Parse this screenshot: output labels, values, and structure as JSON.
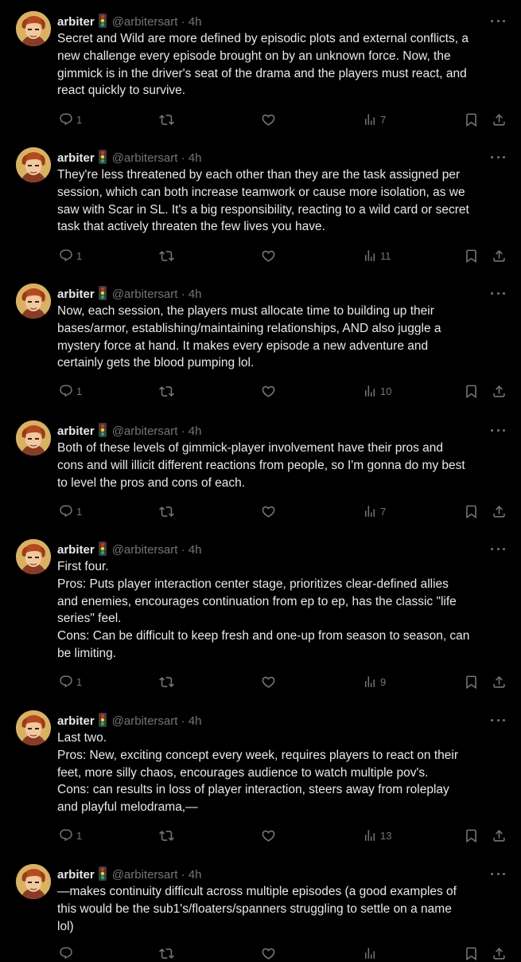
{
  "colors": {
    "background": "#000000",
    "text": "#e7e9ea",
    "muted": "#71767b"
  },
  "tweets": [
    {
      "name": "arbiter",
      "handle": "@arbitersart",
      "dot": "·",
      "time": "4h",
      "lines": [
        "Secret and Wild are more defined by episodic plots and external conflicts, a",
        "new challenge every episode brought on by an unknown force. Now, the",
        "gimmick is in the driver's seat of the drama and the players must react, and",
        "react quickly to survive."
      ],
      "replies": "1",
      "retweets": "",
      "likes": "",
      "views": "7"
    },
    {
      "name": "arbiter",
      "handle": "@arbitersart",
      "dot": "·",
      "time": "4h",
      "lines": [
        "They're less threatened by each other than they are the task assigned per",
        "session, which can both increase teamwork or cause more isolation, as we",
        "saw with Scar in SL. It's a big responsibility, reacting to a wild card or secret",
        "task that actively threaten the few lives you have."
      ],
      "replies": "1",
      "retweets": "",
      "likes": "",
      "views": "11"
    },
    {
      "name": "arbiter",
      "handle": "@arbitersart",
      "dot": "·",
      "time": "4h",
      "lines": [
        "Now, each session, the players must allocate time to building up their",
        "bases/armor, establishing/maintaining relationships, AND also juggle a",
        "mystery force at hand. It makes every episode a new adventure and",
        "certainly gets the blood pumping lol."
      ],
      "replies": "1",
      "retweets": "",
      "likes": "",
      "views": "10"
    },
    {
      "name": "arbiter",
      "handle": "@arbitersart",
      "dot": "·",
      "time": "4h",
      "lines": [
        "Both of these levels of gimmick-player involvement have their pros and",
        "cons and will illicit different reactions from people, so I'm gonna do my best",
        "to level the pros and cons of each."
      ],
      "replies": "1",
      "retweets": "",
      "likes": "",
      "views": "7"
    },
    {
      "name": "arbiter",
      "handle": "@arbitersart",
      "dot": "·",
      "time": "4h",
      "lines": [
        "First four.",
        "Pros: Puts player interaction center stage, prioritizes clear-defined allies",
        "and enemies, encourages continuation from ep to ep, has the classic \"life",
        "series\" feel.",
        "Cons: Can be difficult to keep fresh and one-up from season to season, can",
        "be limiting."
      ],
      "replies": "1",
      "retweets": "",
      "likes": "",
      "views": "9"
    },
    {
      "name": "arbiter",
      "handle": "@arbitersart",
      "dot": "·",
      "time": "4h",
      "lines": [
        "Last two.",
        "Pros: New, exciting concept every week, requires players to react on their",
        "feet, more silly chaos, encourages audience to watch multiple pov's.",
        "Cons: can results in loss of player interaction, steers away from roleplay",
        "and playful melodrama,—"
      ],
      "replies": "1",
      "retweets": "",
      "likes": "",
      "views": "13"
    },
    {
      "name": "arbiter",
      "handle": "@arbitersart",
      "dot": "·",
      "time": "4h",
      "lines": [
        "—makes continuity difficult across multiple episodes (a good examples of",
        "this would be the sub1's/floaters/spanners struggling to settle on a name",
        "lol)"
      ],
      "replies": "",
      "retweets": "",
      "likes": "",
      "views": ""
    }
  ]
}
